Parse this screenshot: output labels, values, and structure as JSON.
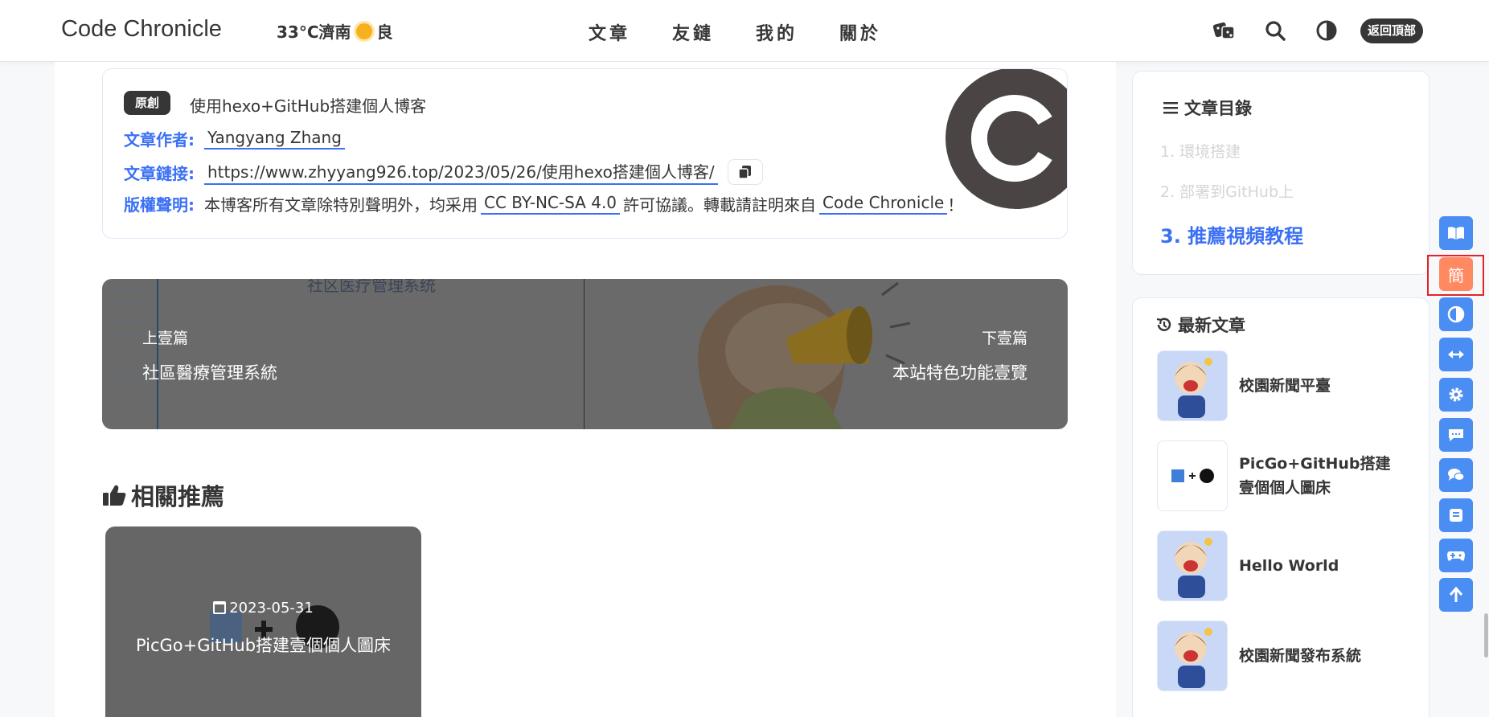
{
  "header": {
    "site_name": "Code Chronicle",
    "weather_text": "33°C濟南",
    "air_quality": "良",
    "nav": [
      "文章",
      "友鏈",
      "我的",
      "關於"
    ],
    "back_to_top": "返回頂部"
  },
  "copyright": {
    "badge": "原創",
    "post_title": "使用hexo+GitHub搭建個人博客",
    "author_key": "文章作者:",
    "author": "Yangyang Zhang",
    "link_key": "文章鏈接:",
    "link": "https://www.zhyyang926.top/2023/05/26/使用hexo搭建個人博客/",
    "license_key": "版權聲明:",
    "license_pre": "本博客所有文章除特別聲明外，均采用",
    "license_name": "CC BY-NC-SA 4.0",
    "license_mid": "許可協議。轉載請註明來自",
    "license_site": "Code Chronicle",
    "license_end": "！"
  },
  "pagination": {
    "prev_label": "上壹篇",
    "prev_title": "社區醫療管理系統",
    "prev_bg_text": "社区医疗管理系统",
    "next_label": "下壹篇",
    "next_title": "本站特色功能壹覽"
  },
  "related": {
    "heading": "相關推薦",
    "card": {
      "date": "2023-05-31",
      "title": "PicGo+GitHub搭建壹個個人圖床"
    }
  },
  "toc": {
    "heading": "文章目錄",
    "items": [
      "1. 環境搭建",
      "2. 部署到GitHub上",
      "3. 推薦視頻教程"
    ],
    "active_index": 2
  },
  "recent": {
    "heading": "最新文章",
    "items": [
      {
        "title": "校園新聞平臺",
        "thumb": "cartoon-avatar"
      },
      {
        "title": "PicGo+GitHub搭建壹個個人圖床",
        "thumb": "picgo-github-logo"
      },
      {
        "title": "Hello World",
        "thumb": "cartoon-avatar"
      },
      {
        "title": "校園新聞發布系統",
        "thumb": "cartoon-avatar"
      }
    ]
  },
  "float_bar": {
    "simplified_label": "簡",
    "buttons": [
      "book-icon",
      "simplified-toggle",
      "contrast-icon",
      "arrows-h-icon",
      "gear-icon",
      "sms-icon",
      "comments-icon",
      "danmaku-icon",
      "gamepad-icon",
      "arrow-up-icon"
    ]
  },
  "colors": {
    "accent": "#3b70f5",
    "float_button": "#4a8ef4",
    "highlight": "#ff8a61",
    "dark": "#363636"
  }
}
